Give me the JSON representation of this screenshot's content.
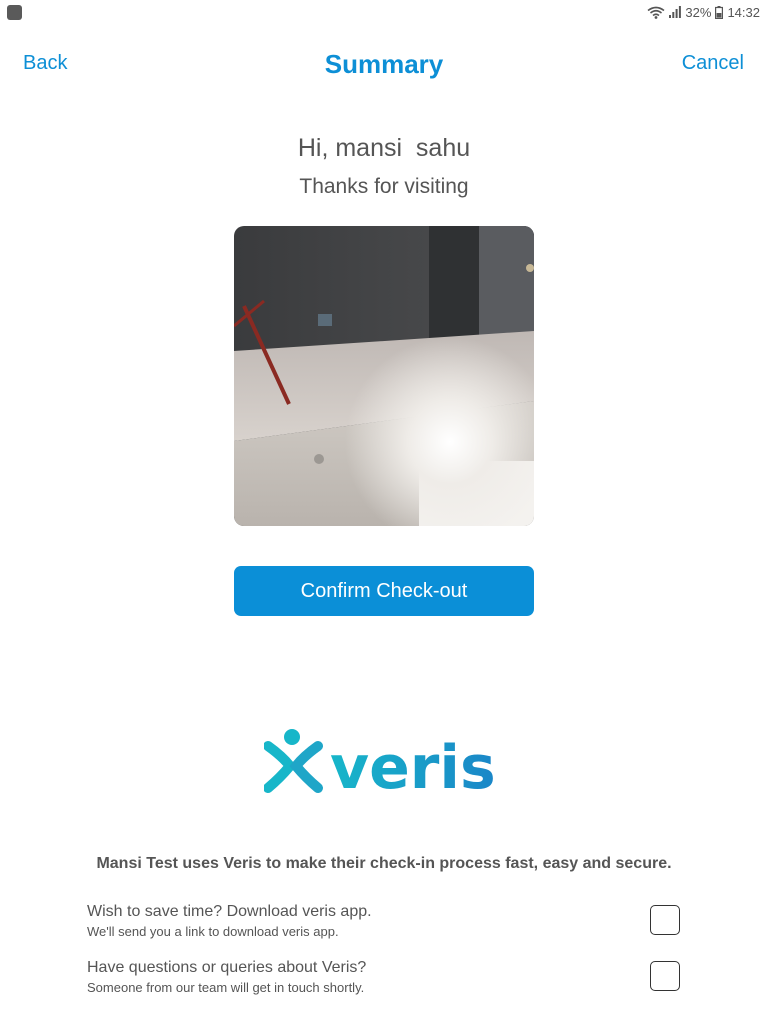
{
  "status_bar": {
    "battery": "32%",
    "time": "14:32"
  },
  "nav": {
    "back_label": "Back",
    "title": "Summary",
    "cancel_label": "Cancel"
  },
  "greeting": "Hi, mansi  sahu",
  "thanks": "Thanks for visiting",
  "confirm_button_label": "Confirm Check-out",
  "brand": {
    "name": "veris",
    "colors": {
      "teal": "#17b6c9",
      "blue": "#1a86c8"
    }
  },
  "uses_text": "Mansi Test uses Veris to make their check-in process fast, easy and secure.",
  "options": [
    {
      "title": "Wish to save time? Download veris app.",
      "subtitle": "We'll send you a link to download veris app.",
      "checked": false
    },
    {
      "title": "Have questions or queries about Veris?",
      "subtitle": "Someone from our team will get in touch shortly.",
      "checked": false
    }
  ]
}
